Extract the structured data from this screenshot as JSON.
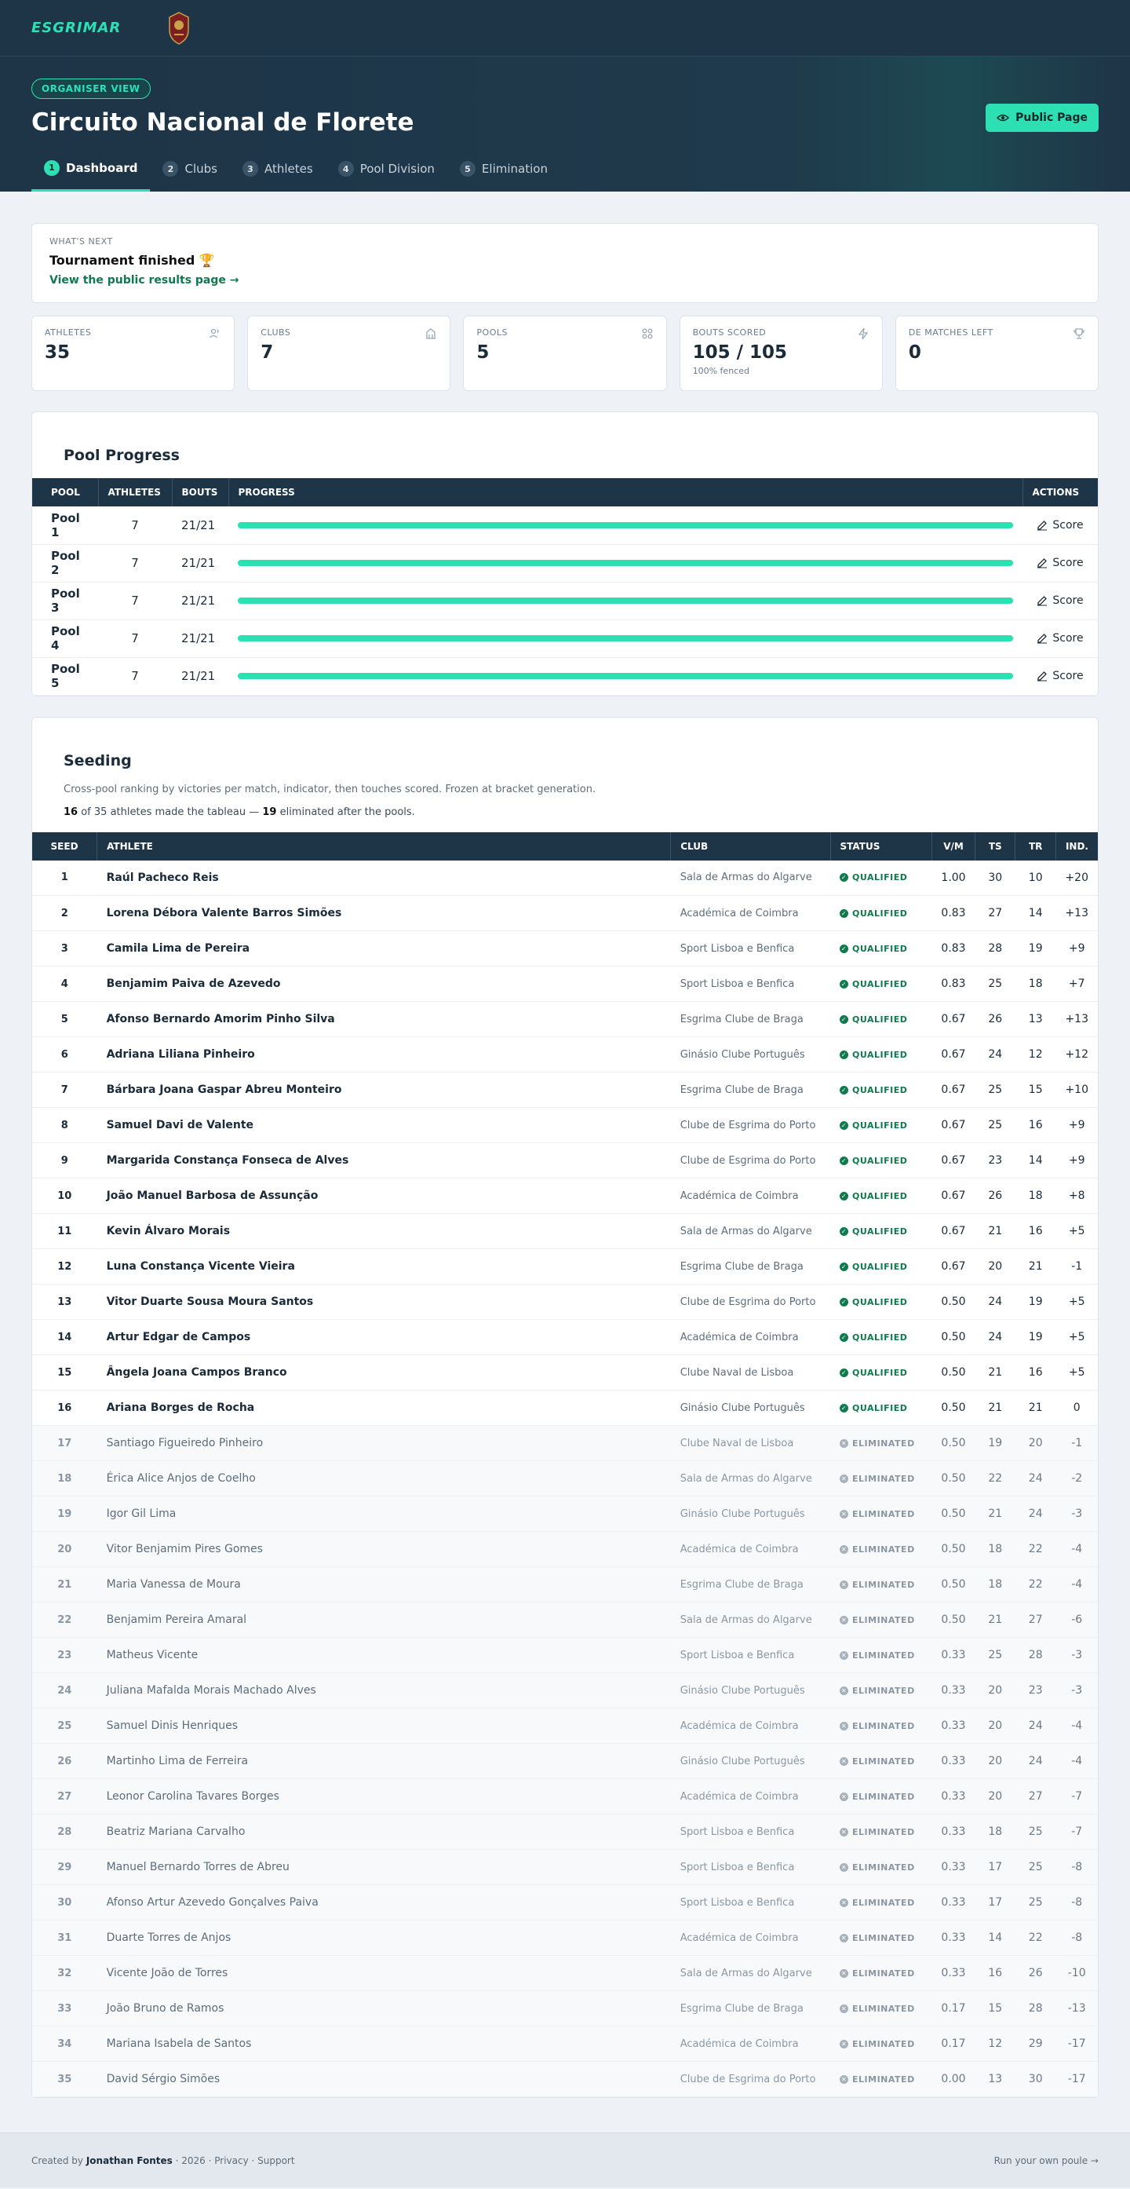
{
  "brand": {
    "logo": "ESGRIMAR"
  },
  "hero": {
    "badge": "ORGANISER VIEW",
    "title": "Circuito Nacional de Florete",
    "public_button": "Public Page"
  },
  "tabs": [
    {
      "num": "1",
      "label": "Dashboard",
      "active": true
    },
    {
      "num": "2",
      "label": "Clubs"
    },
    {
      "num": "3",
      "label": "Athletes"
    },
    {
      "num": "4",
      "label": "Pool Division"
    },
    {
      "num": "5",
      "label": "Elimination"
    }
  ],
  "next": {
    "label": "WHAT'S NEXT",
    "title": "Tournament finished 🏆",
    "link": "View the public results page →"
  },
  "stats": [
    {
      "label": "ATHLETES",
      "value": "35",
      "icon": "users-icon"
    },
    {
      "label": "CLUBS",
      "value": "7",
      "icon": "building-icon"
    },
    {
      "label": "POOLS",
      "value": "5",
      "icon": "grid-icon"
    },
    {
      "label": "BOUTS SCORED",
      "value": "105 / 105",
      "sub": "100% fenced",
      "icon": "bolt-icon"
    },
    {
      "label": "DE MATCHES LEFT",
      "value": "0",
      "icon": "trophy-icon"
    }
  ],
  "pool_progress": {
    "title": "Pool Progress",
    "headers": [
      "POOL",
      "ATHLETES",
      "BOUTS",
      "PROGRESS",
      "ACTIONS"
    ],
    "action_label": "Score",
    "rows": [
      {
        "pool": "Pool 1",
        "athletes": "7",
        "bouts": "21/21",
        "progress": 1.0
      },
      {
        "pool": "Pool 2",
        "athletes": "7",
        "bouts": "21/21",
        "progress": 1.0
      },
      {
        "pool": "Pool 3",
        "athletes": "7",
        "bouts": "21/21",
        "progress": 1.0
      },
      {
        "pool": "Pool 4",
        "athletes": "7",
        "bouts": "21/21",
        "progress": 1.0
      },
      {
        "pool": "Pool 5",
        "athletes": "7",
        "bouts": "21/21",
        "progress": 1.0
      }
    ]
  },
  "seeding": {
    "title": "Seeding",
    "description": "Cross-pool ranking by victories per match, indicator, then touches scored. Frozen at bracket generation.",
    "summary": {
      "made": "16",
      "total_text": " of 35 athletes made the tableau — ",
      "eliminated": "19",
      "tail": " eliminated after the pools."
    },
    "headers": [
      "SEED",
      "ATHLETE",
      "CLUB",
      "STATUS",
      "V/M",
      "TS",
      "TR",
      "IND."
    ],
    "rows": [
      [
        "1",
        "Raúl Pacheco Reis",
        "Sala de Armas do Algarve",
        "QUALIFIED",
        "1.00",
        "30",
        "10",
        "+20"
      ],
      [
        "2",
        "Lorena Débora Valente Barros Simões",
        "Académica de Coimbra",
        "QUALIFIED",
        "0.83",
        "27",
        "14",
        "+13"
      ],
      [
        "3",
        "Camila Lima de Pereira",
        "Sport Lisboa e Benfica",
        "QUALIFIED",
        "0.83",
        "28",
        "19",
        "+9"
      ],
      [
        "4",
        "Benjamim Paiva de Azevedo",
        "Sport Lisboa e Benfica",
        "QUALIFIED",
        "0.83",
        "25",
        "18",
        "+7"
      ],
      [
        "5",
        "Afonso Bernardo Amorim Pinho Silva",
        "Esgrima Clube de Braga",
        "QUALIFIED",
        "0.67",
        "26",
        "13",
        "+13"
      ],
      [
        "6",
        "Adriana Liliana Pinheiro",
        "Ginásio Clube Português",
        "QUALIFIED",
        "0.67",
        "24",
        "12",
        "+12"
      ],
      [
        "7",
        "Bárbara Joana Gaspar Abreu Monteiro",
        "Esgrima Clube de Braga",
        "QUALIFIED",
        "0.67",
        "25",
        "15",
        "+10"
      ],
      [
        "8",
        "Samuel Davi de Valente",
        "Clube de Esgrima do Porto",
        "QUALIFIED",
        "0.67",
        "25",
        "16",
        "+9"
      ],
      [
        "9",
        "Margarida Constança Fonseca de Alves",
        "Clube de Esgrima do Porto",
        "QUALIFIED",
        "0.67",
        "23",
        "14",
        "+9"
      ],
      [
        "10",
        "João Manuel Barbosa de Assunção",
        "Académica de Coimbra",
        "QUALIFIED",
        "0.67",
        "26",
        "18",
        "+8"
      ],
      [
        "11",
        "Kevin Álvaro Morais",
        "Sala de Armas do Algarve",
        "QUALIFIED",
        "0.67",
        "21",
        "16",
        "+5"
      ],
      [
        "12",
        "Luna Constança Vicente Vieira",
        "Esgrima Clube de Braga",
        "QUALIFIED",
        "0.67",
        "20",
        "21",
        "-1"
      ],
      [
        "13",
        "Vitor Duarte Sousa Moura Santos",
        "Clube de Esgrima do Porto",
        "QUALIFIED",
        "0.50",
        "24",
        "19",
        "+5"
      ],
      [
        "14",
        "Artur Edgar de Campos",
        "Académica de Coimbra",
        "QUALIFIED",
        "0.50",
        "24",
        "19",
        "+5"
      ],
      [
        "15",
        "Ângela Joana Campos Branco",
        "Clube Naval de Lisboa",
        "QUALIFIED",
        "0.50",
        "21",
        "16",
        "+5"
      ],
      [
        "16",
        "Ariana Borges de Rocha",
        "Ginásio Clube Português",
        "QUALIFIED",
        "0.50",
        "21",
        "21",
        "0"
      ],
      [
        "17",
        "Santiago Figueiredo Pinheiro",
        "Clube Naval de Lisboa",
        "ELIMINATED",
        "0.50",
        "19",
        "20",
        "-1"
      ],
      [
        "18",
        "Érica Alice Anjos de Coelho",
        "Sala de Armas do Algarve",
        "ELIMINATED",
        "0.50",
        "22",
        "24",
        "-2"
      ],
      [
        "19",
        "Igor Gil Lima",
        "Ginásio Clube Português",
        "ELIMINATED",
        "0.50",
        "21",
        "24",
        "-3"
      ],
      [
        "20",
        "Vitor Benjamim Pires Gomes",
        "Académica de Coimbra",
        "ELIMINATED",
        "0.50",
        "18",
        "22",
        "-4"
      ],
      [
        "21",
        "Maria Vanessa de Moura",
        "Esgrima Clube de Braga",
        "ELIMINATED",
        "0.50",
        "18",
        "22",
        "-4"
      ],
      [
        "22",
        "Benjamim Pereira Amaral",
        "Sala de Armas do Algarve",
        "ELIMINATED",
        "0.50",
        "21",
        "27",
        "-6"
      ],
      [
        "23",
        "Matheus Vicente",
        "Sport Lisboa e Benfica",
        "ELIMINATED",
        "0.33",
        "25",
        "28",
        "-3"
      ],
      [
        "24",
        "Juliana Mafalda Morais Machado Alves",
        "Ginásio Clube Português",
        "ELIMINATED",
        "0.33",
        "20",
        "23",
        "-3"
      ],
      [
        "25",
        "Samuel Dinis Henriques",
        "Académica de Coimbra",
        "ELIMINATED",
        "0.33",
        "20",
        "24",
        "-4"
      ],
      [
        "26",
        "Martinho Lima de Ferreira",
        "Ginásio Clube Português",
        "ELIMINATED",
        "0.33",
        "20",
        "24",
        "-4"
      ],
      [
        "27",
        "Leonor Carolina Tavares Borges",
        "Académica de Coimbra",
        "ELIMINATED",
        "0.33",
        "20",
        "27",
        "-7"
      ],
      [
        "28",
        "Beatriz Mariana Carvalho",
        "Sport Lisboa e Benfica",
        "ELIMINATED",
        "0.33",
        "18",
        "25",
        "-7"
      ],
      [
        "29",
        "Manuel Bernardo Torres de Abreu",
        "Sport Lisboa e Benfica",
        "ELIMINATED",
        "0.33",
        "17",
        "25",
        "-8"
      ],
      [
        "30",
        "Afonso Artur Azevedo Gonçalves Paiva",
        "Sport Lisboa e Benfica",
        "ELIMINATED",
        "0.33",
        "17",
        "25",
        "-8"
      ],
      [
        "31",
        "Duarte Torres de Anjos",
        "Académica de Coimbra",
        "ELIMINATED",
        "0.33",
        "14",
        "22",
        "-8"
      ],
      [
        "32",
        "Vicente João de Torres",
        "Sala de Armas do Algarve",
        "ELIMINATED",
        "0.33",
        "16",
        "26",
        "-10"
      ],
      [
        "33",
        "João Bruno de Ramos",
        "Esgrima Clube de Braga",
        "ELIMINATED",
        "0.17",
        "15",
        "28",
        "-13"
      ],
      [
        "34",
        "Mariana Isabela de Santos",
        "Académica de Coimbra",
        "ELIMINATED",
        "0.17",
        "12",
        "29",
        "-17"
      ],
      [
        "35",
        "David Sérgio Simões",
        "Clube de Esgrima do Porto",
        "ELIMINATED",
        "0.00",
        "13",
        "30",
        "-17"
      ]
    ]
  },
  "footer": {
    "created_by": "Created by ",
    "author": "Jonathan Fontes",
    "rest": " · 2026 · Privacy · Support",
    "right": "Run your own poule →"
  },
  "colors": {
    "accent": "#2de0b4",
    "navy": "#1e3447",
    "qualified": "#0f7a4e"
  }
}
